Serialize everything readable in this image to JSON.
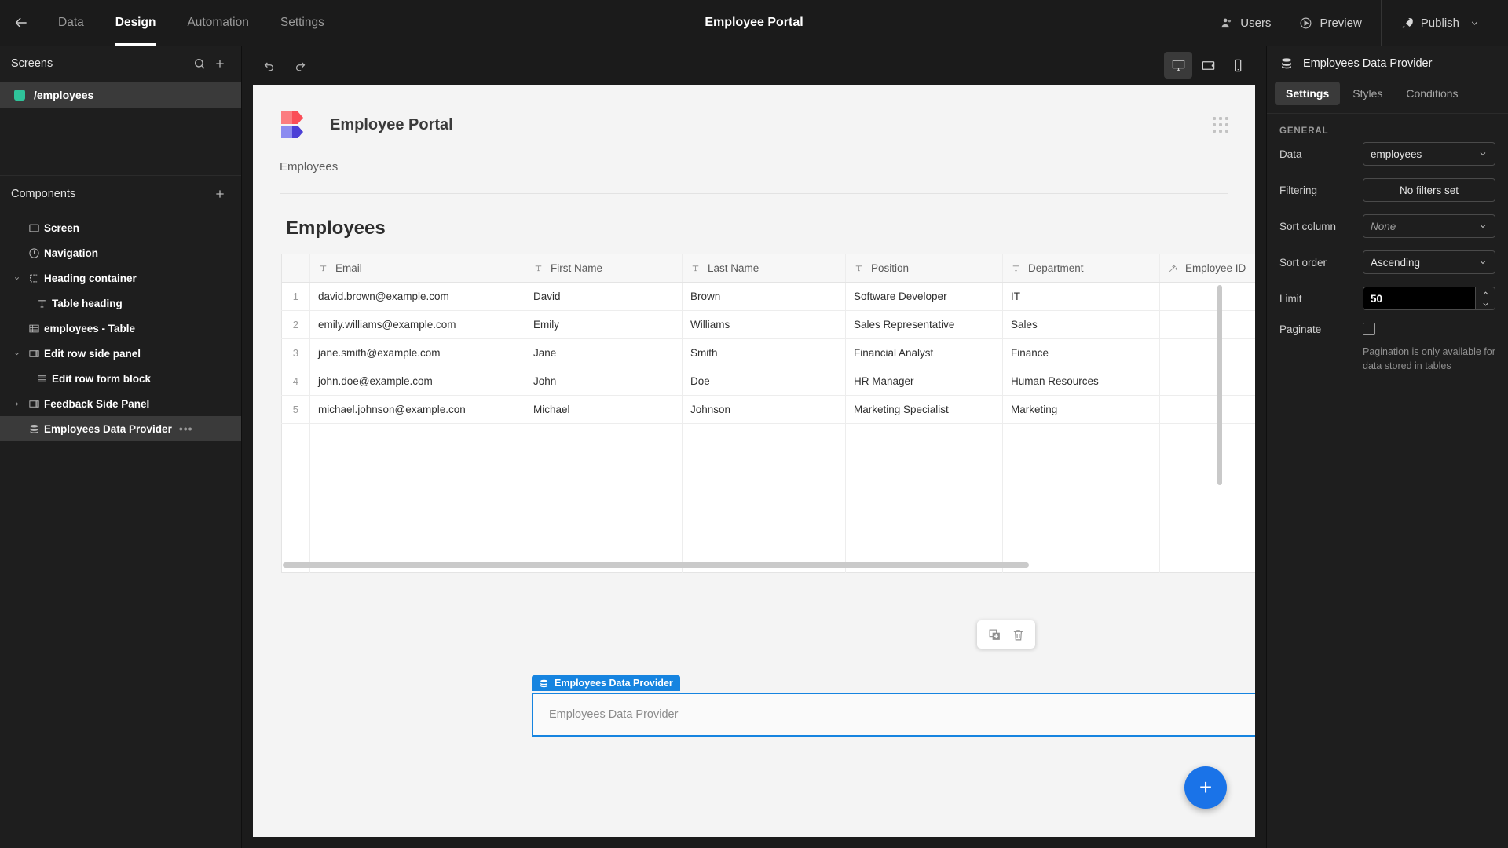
{
  "topbar": {
    "back_icon": "arrow-left-icon",
    "tabs": [
      {
        "label": "Data",
        "active": false
      },
      {
        "label": "Design",
        "active": true
      },
      {
        "label": "Automation",
        "active": false
      },
      {
        "label": "Settings",
        "active": false
      }
    ],
    "title": "Employee Portal",
    "users_label": "Users",
    "preview_label": "Preview",
    "publish_label": "Publish"
  },
  "sidebar": {
    "screens_title": "Screens",
    "search_icon": "search-icon",
    "add_icon": "plus-icon",
    "screens": [
      {
        "label": "/employees",
        "selected": true,
        "color": "#2fc39a"
      }
    ],
    "components_title": "Components",
    "components_add_icon": "plus-icon",
    "components": [
      {
        "label": "Screen",
        "icon": "screen-icon",
        "indent": 0,
        "caret": "",
        "selected": false
      },
      {
        "label": "Navigation",
        "icon": "navigation-icon",
        "indent": 0,
        "caret": "",
        "selected": false
      },
      {
        "label": "Heading container",
        "icon": "container-icon",
        "indent": 0,
        "caret": "down",
        "selected": false
      },
      {
        "label": "Table heading",
        "icon": "text-icon",
        "indent": 1,
        "caret": "",
        "selected": false
      },
      {
        "label": "employees - Table",
        "icon": "table-icon",
        "indent": 0,
        "caret": "",
        "selected": false
      },
      {
        "label": "Edit row side panel",
        "icon": "side-panel-icon",
        "indent": 0,
        "caret": "down",
        "selected": false
      },
      {
        "label": "Edit row form block",
        "icon": "form-icon",
        "indent": 1,
        "caret": "",
        "selected": false
      },
      {
        "label": "Feedback Side Panel",
        "icon": "side-panel-icon",
        "indent": 0,
        "caret": "right",
        "selected": false
      },
      {
        "label": "Employees Data Provider",
        "icon": "database-icon",
        "indent": 0,
        "caret": "",
        "selected": true,
        "menu": "•••"
      }
    ]
  },
  "canvas_toolbar": {
    "undo_icon": "undo-icon",
    "redo_icon": "redo-icon",
    "devices": [
      {
        "name": "desktop-view",
        "active": true
      },
      {
        "name": "tablet-view",
        "active": false
      },
      {
        "name": "mobile-view",
        "active": false
      }
    ]
  },
  "canvas": {
    "app_name": "Employee Portal",
    "logo_colors": {
      "top": "#ff5a5f",
      "bottom": "#4b43d8"
    },
    "nav_link": "Employees",
    "grip_icon": "drag-grip-icon",
    "page_title": "Employees",
    "table": {
      "columns": [
        {
          "label": "Email",
          "icon": "text-type-icon"
        },
        {
          "label": "First Name",
          "icon": "text-type-icon"
        },
        {
          "label": "Last Name",
          "icon": "text-type-icon"
        },
        {
          "label": "Position",
          "icon": "text-type-icon"
        },
        {
          "label": "Department",
          "icon": "text-type-icon"
        },
        {
          "label": "Employee ID",
          "icon": "formula-wand-icon"
        }
      ],
      "rows": [
        {
          "index": "1",
          "email": "david.brown@example.com",
          "first_name": "David",
          "last_name": "Brown",
          "position": "Software Developer",
          "department": "IT",
          "employee_id": ""
        },
        {
          "index": "2",
          "email": "emily.williams@example.com",
          "first_name": "Emily",
          "last_name": "Williams",
          "position": "Sales Representative",
          "department": "Sales",
          "employee_id": ""
        },
        {
          "index": "3",
          "email": "jane.smith@example.com",
          "first_name": "Jane",
          "last_name": "Smith",
          "position": "Financial Analyst",
          "department": "Finance",
          "employee_id": ""
        },
        {
          "index": "4",
          "email": "john.doe@example.com",
          "first_name": "John",
          "last_name": "Doe",
          "position": "HR Manager",
          "department": "Human Resources",
          "employee_id": ""
        },
        {
          "index": "5",
          "email": "michael.johnson@example.con",
          "first_name": "Michael",
          "last_name": "Johnson",
          "position": "Marketing Specialist",
          "department": "Marketing",
          "employee_id": ""
        }
      ]
    },
    "float_tools": [
      {
        "name": "duplicate-icon"
      },
      {
        "name": "delete-icon"
      }
    ],
    "selected_block": {
      "badge_label": "Employees Data Provider",
      "badge_icon": "database-icon",
      "body_label": "Employees Data Provider",
      "accent": "#1684e0"
    },
    "fab_label": "+"
  },
  "properties": {
    "header_icon": "database-icon",
    "header_title": "Employees Data Provider",
    "tabs": [
      {
        "label": "Settings",
        "active": true
      },
      {
        "label": "Styles",
        "active": false
      },
      {
        "label": "Conditions",
        "active": false
      }
    ],
    "section_title": "GENERAL",
    "fields": {
      "data_label": "Data",
      "data_value": "employees",
      "filtering_label": "Filtering",
      "filtering_value": "No filters set",
      "sort_column_label": "Sort column",
      "sort_column_value": "None",
      "sort_order_label": "Sort order",
      "sort_order_value": "Ascending",
      "limit_label": "Limit",
      "limit_value": "50",
      "paginate_label": "Paginate",
      "paginate_hint": "Pagination is only available for data stored in tables"
    }
  }
}
